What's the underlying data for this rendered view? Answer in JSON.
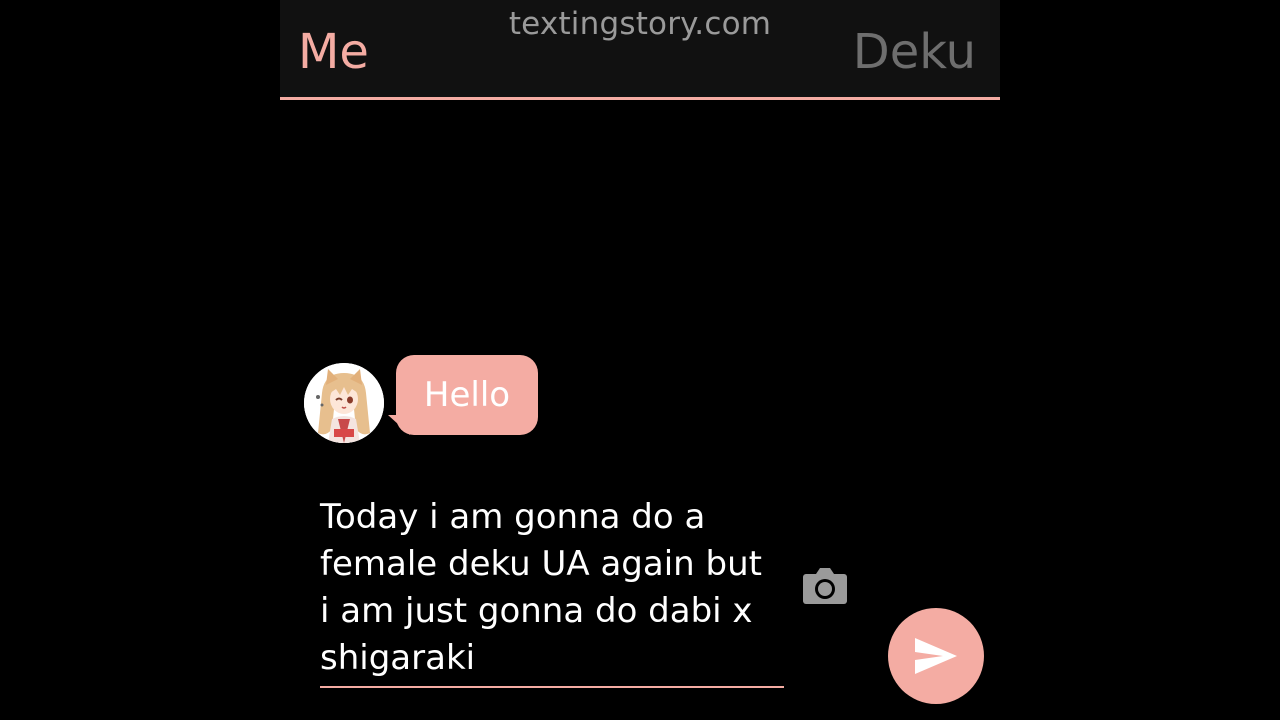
{
  "header": {
    "watermark": "textingstory.com",
    "left_name": "Me",
    "right_name": "Deku"
  },
  "messages": [
    {
      "sender": "Deku",
      "text": "Hello"
    }
  ],
  "composer": {
    "text": "Today i am gonna do a\nfemale deku UA again but\ni am just gonna do dabi x\nshigaraki"
  },
  "icons": {
    "camera": "camera-icon",
    "send": "send-arrow-icon",
    "avatar": "anime-avatar"
  },
  "colors": {
    "accent": "#f4aca3",
    "header_bg": "#111111",
    "inactive": "#6e6e6e",
    "watermark": "#9a9a9a"
  }
}
